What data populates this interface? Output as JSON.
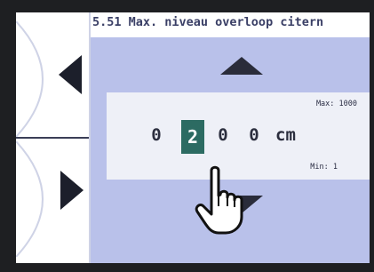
{
  "header": {
    "title": "5.51 Max. niveau overloop citern"
  },
  "entry": {
    "max_label": "Max: 1000",
    "min_label": "Min: 1",
    "digits": [
      "0",
      "2",
      "0",
      "0"
    ],
    "selected_digit_index": 1,
    "unit": "cm"
  },
  "colors": {
    "screen_bg": "#b9c1ea",
    "panel_bg": "#eef0f7",
    "selected_digit_bg": "#2c6b62",
    "title_color": "#3a3f66"
  },
  "icons": {
    "nav_previous": "triangle-left-icon",
    "nav_next": "triangle-right-icon",
    "increment": "arrow-up-icon",
    "decrement": "arrow-down-icon",
    "pointer": "pointing-hand-icon"
  }
}
